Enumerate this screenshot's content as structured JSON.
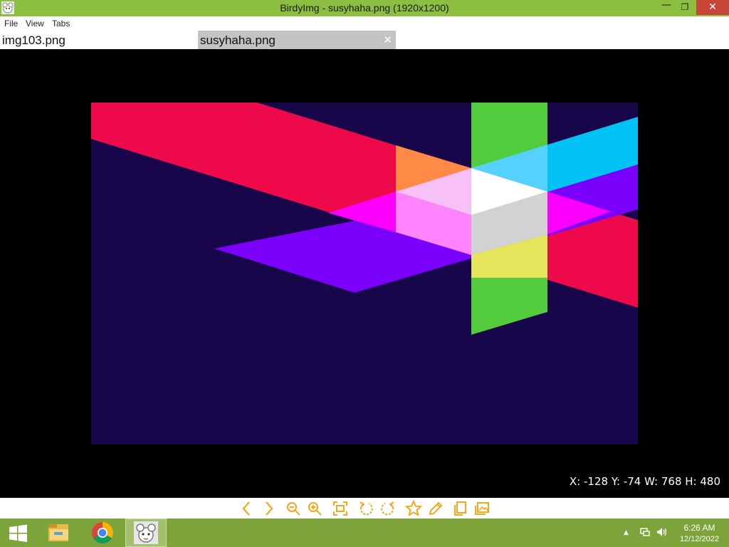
{
  "window": {
    "title": "BirdyImg - susyhaha.png (1920x1200)",
    "minimize_glyph": "—",
    "restore_glyph": "❐",
    "close_glyph": "✕"
  },
  "menu": {
    "items": [
      {
        "label": "File"
      },
      {
        "label": "View"
      },
      {
        "label": "Tabs"
      }
    ]
  },
  "tabs": [
    {
      "label": "img103.png",
      "active": false
    },
    {
      "label": "susyhaha.png",
      "active": true,
      "close_glyph": "✕"
    }
  ],
  "viewer": {
    "coords_text": "X: -128 Y: -74 W: 768 H: 480",
    "background": "#000000",
    "image_colors": {
      "base": "#170649",
      "red": "#ee0a4a",
      "green": "#52cc3c",
      "cyan": "#00c2f5",
      "purple": "#7b00fb",
      "orange": "#ff8a45",
      "magenta": "#fd00fd",
      "pink": "#ff82ff",
      "lightpink": "#f7c0f7",
      "white": "#ffffff",
      "lightblue": "#56d0ff",
      "gray": "#d2d2d2",
      "yellow": "#e4e55a"
    }
  },
  "toolbar": {
    "accent_color": "#f5a71a",
    "tools": [
      {
        "icon": "chevron-left-icon"
      },
      {
        "icon": "chevron-right-icon"
      },
      {
        "icon": "zoom-out-icon"
      },
      {
        "icon": "zoom-in-icon"
      },
      {
        "icon": "fit-screen-icon"
      },
      {
        "icon": "rotate-left-icon"
      },
      {
        "icon": "rotate-right-icon"
      },
      {
        "icon": "star-icon"
      },
      {
        "icon": "pencil-icon"
      },
      {
        "icon": "copy-icon"
      },
      {
        "icon": "gallery-icon"
      }
    ]
  },
  "taskbar": {
    "color": "#7da33b",
    "apps": [
      {
        "icon": "windows-start-icon"
      },
      {
        "icon": "file-explorer-icon"
      },
      {
        "icon": "chrome-icon"
      },
      {
        "icon": "birdyimg-app-icon"
      }
    ],
    "tray": {
      "chevron_glyph": "▲",
      "clock_time": "6:26 AM",
      "clock_date": "12/12/2022"
    }
  }
}
